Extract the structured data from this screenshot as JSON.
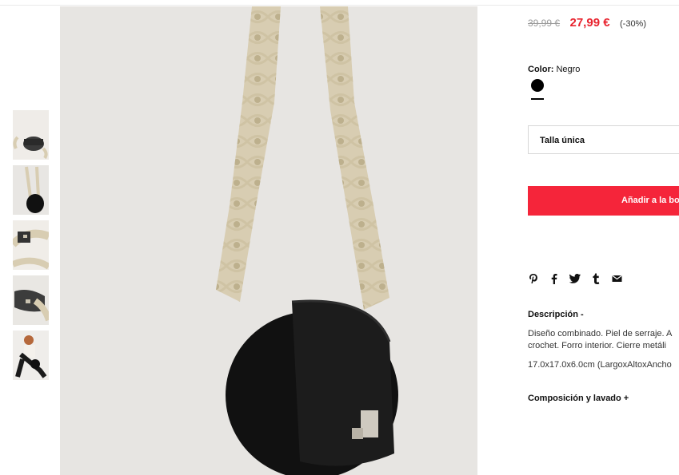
{
  "product": {
    "old_price": "39,99 €",
    "new_price": "27,99 €",
    "discount": "(-30%)",
    "color_label": "Color:",
    "color_value": "Negro",
    "size": "Talla única",
    "add_to_bag": "Añadir a la bo"
  },
  "share": {
    "icons": [
      "pinterest-icon",
      "facebook-icon",
      "twitter-icon",
      "tumblr-icon",
      "mail-icon"
    ]
  },
  "description": {
    "title": "Descripción  -",
    "line1": "Diseño combinado. Piel de serraje. A",
    "line2": "crochet. Forro interior. Cierre metáli",
    "dimensions": "17.0x17.0x6.0cm (LargoxAltoxAncho"
  },
  "composition": {
    "title": "Composición y lavado  +"
  },
  "colors": {
    "price_red": "#e8232e",
    "button_red": "#f5253a",
    "swatch": "#000000",
    "strap": "#d8cdb2"
  }
}
